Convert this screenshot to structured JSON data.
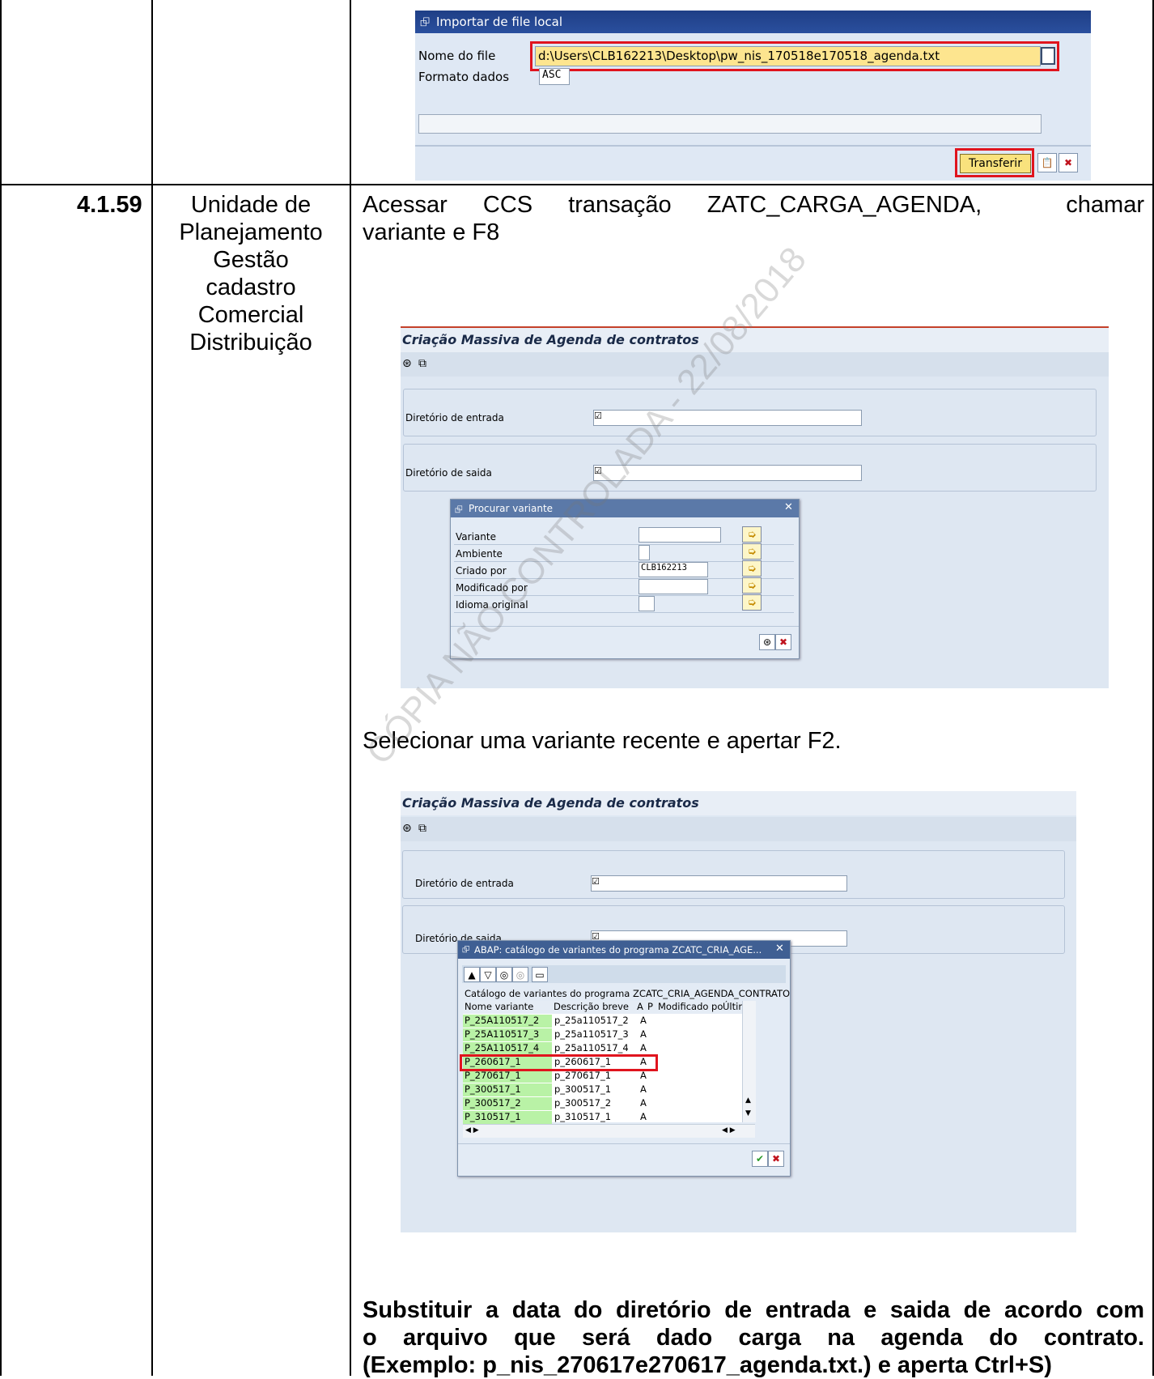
{
  "doc": {
    "row_number": "4.1.59",
    "responsible_lines": [
      "Unidade de",
      "Planejamento",
      "Gestão",
      "cadastro",
      "Comercial",
      "Distribuição"
    ],
    "step_text_line1": [
      "Acessar",
      "CCS",
      "transação",
      "ZATC_CARGA_AGENDA,",
      "chamar"
    ],
    "step_text_line2": "variante e F8",
    "select_text": "Selecionar uma variante recente e apertar F2.",
    "final_lines": [
      "Substituir a data do diretório de entrada e saida de acordo com",
      "o arquivo que será dado carga na agenda do contrato.",
      "(Exemplo: p_nis_270617e270617_agenda.txt.) e aperta Ctrl+S)"
    ],
    "watermark": "CÓPIA NÃO CONTROLADA - 22/08/2018"
  },
  "import_dialog": {
    "title": "Importar de file local",
    "file_label": "Nome do file",
    "file_value": "d:\\Users\\CLB162213\\Desktop\\pw_nis_170518e170518_agenda.txt",
    "format_label": "Formato dados",
    "format_value": "ASC",
    "transfer_button": "Transferir"
  },
  "screen1": {
    "title": "Criação Massiva de Agenda de contratos",
    "input_dir_label": "Diretório de entrada",
    "output_dir_label": "Diretório de saida",
    "popup": {
      "title": "Procurar variante",
      "fields": [
        {
          "label": "Variante",
          "value": ""
        },
        {
          "label": "Ambiente",
          "value": ""
        },
        {
          "label": "Criado por",
          "value": "CLB162213"
        },
        {
          "label": "Modificado por",
          "value": ""
        },
        {
          "label": "Idioma original",
          "value": ""
        }
      ]
    }
  },
  "screen2": {
    "title": "Criação Massiva de Agenda de contratos",
    "input_dir_label": "Diretório de entrada",
    "output_dir_label": "Diretório de saida",
    "popup": {
      "title": "ABAP: catálogo de variantes do programa ZCATC_CRIA_AGE...",
      "caption": "Catálogo de variantes do programa ZCATC_CRIA_AGENDA_CONTRATO",
      "columns": [
        "Nome variante",
        "Descrição breve",
        "A",
        "P",
        "Modificado por",
        "Últir"
      ],
      "rows": [
        {
          "name": "P_25A110517_2",
          "desc": "p_25a110517_2",
          "a": "A"
        },
        {
          "name": "P_25A110517_3",
          "desc": "p_25a110517_3",
          "a": "A"
        },
        {
          "name": "P_25A110517_4",
          "desc": "p_25a110517_4",
          "a": "A"
        },
        {
          "name": "P_260617_1",
          "desc": "p_260617_1",
          "a": "A"
        },
        {
          "name": "P_270617_1",
          "desc": "p_270617_1",
          "a": "A"
        },
        {
          "name": "P_300517_1",
          "desc": "p_300517_1",
          "a": "A"
        },
        {
          "name": "P_300517_2",
          "desc": "p_300517_2",
          "a": "A"
        },
        {
          "name": "P_310517_1",
          "desc": "p_310517_1",
          "a": "A"
        }
      ],
      "highlighted_row": "P_260617_1"
    }
  },
  "colors": {
    "sap_title_blue": "#1f3f86",
    "highlight_red": "#e0141e",
    "row_green": "#b9f2a6",
    "transfer_yellow": "#f9e27d"
  }
}
